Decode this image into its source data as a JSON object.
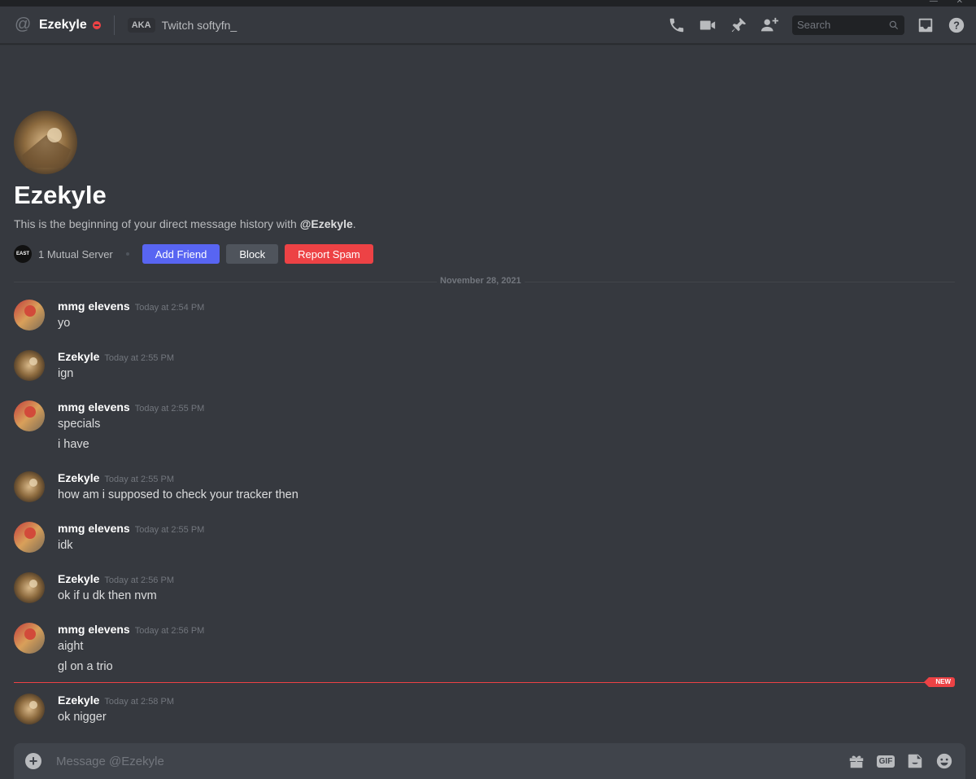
{
  "header": {
    "name": "Ezekyle",
    "aka_badge": "AKA",
    "aka_names": "Twitch softyfn_",
    "search_placeholder": "Search"
  },
  "intro": {
    "name": "Ezekyle",
    "desc_prefix": "This is the beginning of your direct message history with ",
    "desc_user": "@Ezekyle",
    "desc_suffix": ".",
    "server_icon_text": "EAST",
    "mutual": "1 Mutual Server",
    "add_friend": "Add Friend",
    "block": "Block",
    "report_spam": "Report Spam"
  },
  "date_divider": "November 28, 2021",
  "messages": [
    {
      "author": "mmg elevens",
      "time": "Today at 2:54 PM",
      "lines": [
        "yo"
      ]
    },
    {
      "author": "Ezekyle",
      "time": "Today at 2:55 PM",
      "lines": [
        "ign"
      ]
    },
    {
      "author": "mmg elevens",
      "time": "Today at 2:55 PM",
      "lines": [
        "specials",
        "i have"
      ]
    },
    {
      "author": "Ezekyle",
      "time": "Today at 2:55 PM",
      "lines": [
        "how am i supposed to check your tracker then"
      ]
    },
    {
      "author": "mmg elevens",
      "time": "Today at 2:55 PM",
      "lines": [
        "idk"
      ]
    },
    {
      "author": "Ezekyle",
      "time": "Today at 2:56 PM",
      "lines": [
        "ok if u dk then nvm"
      ]
    },
    {
      "author": "mmg elevens",
      "time": "Today at 2:56 PM",
      "lines": [
        "aight",
        "gl on a trio"
      ]
    },
    {
      "author": "Ezekyle",
      "time": "Today at 2:58 PM",
      "lines": [
        "ok nigger"
      ]
    }
  ],
  "new_marker": "NEW",
  "composer": {
    "placeholder": "Message @Ezekyle",
    "gif_label": "GIF"
  },
  "colors": {
    "background": "#36393f",
    "blurple": "#5865f2",
    "danger": "#ed4245",
    "dnd_status": "#ed4245"
  },
  "icons": [
    "at-icon",
    "voice-call-icon",
    "video-call-icon",
    "pin-icon",
    "add-member-icon",
    "search-icon",
    "inbox-icon",
    "help-icon",
    "add-attachment-icon",
    "gift-icon",
    "gif-icon",
    "sticker-icon",
    "emoji-icon"
  ]
}
